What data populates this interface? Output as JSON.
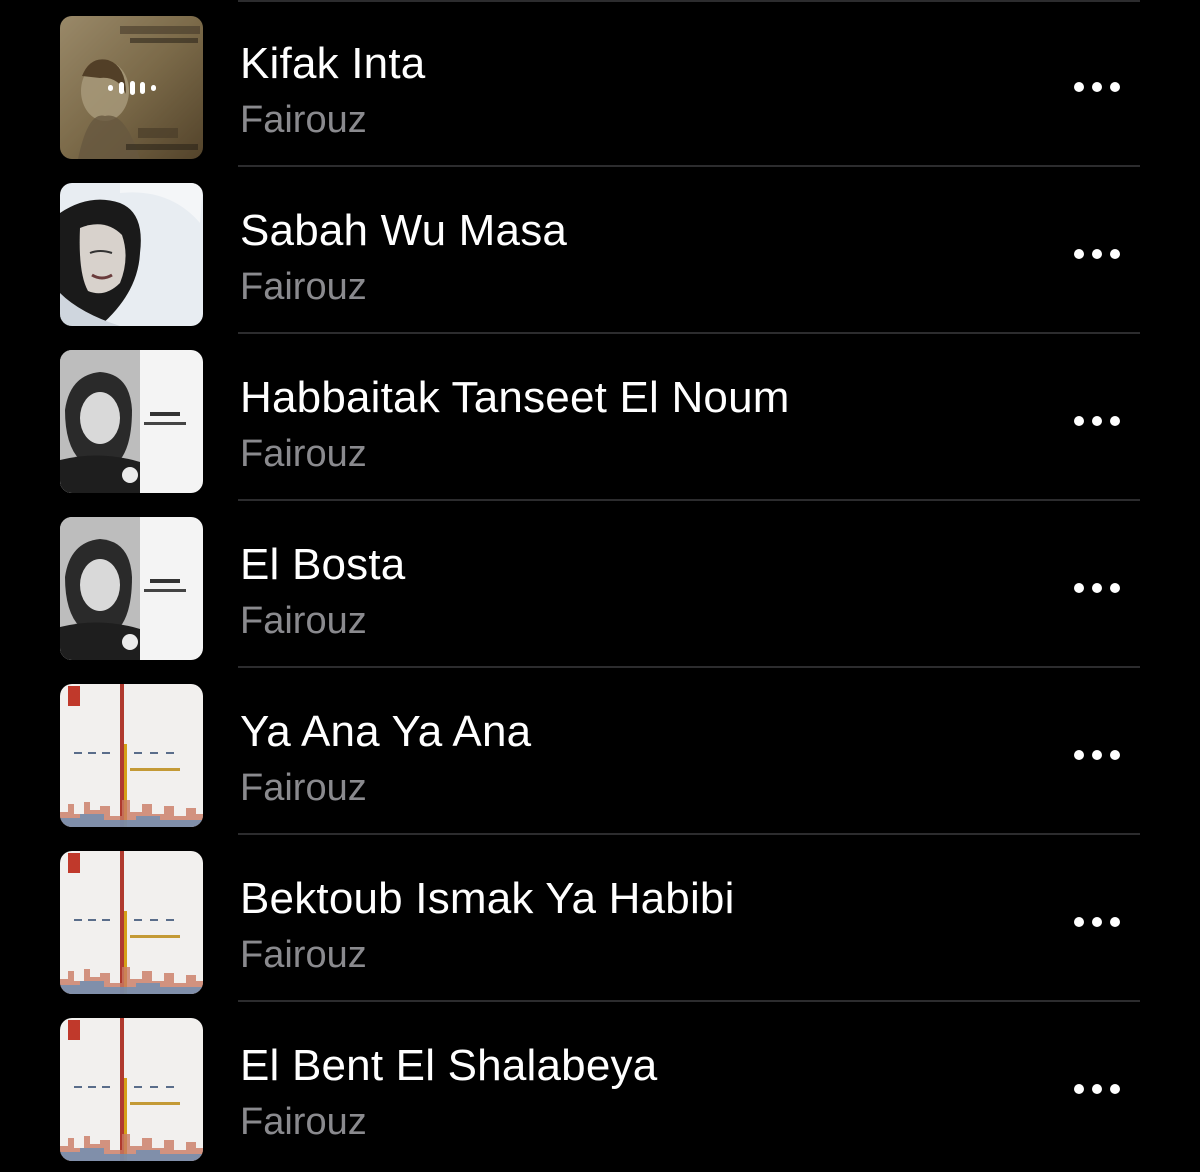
{
  "songs": [
    {
      "title": "Kifak Inta",
      "artist": "Fairouz",
      "artwork": "kifak-inta-cover",
      "now_playing": true
    },
    {
      "title": "Sabah Wu Masa",
      "artist": "Fairouz",
      "artwork": "portrait-cover"
    },
    {
      "title": "Habbaitak Tanseet El Noum",
      "artist": "Fairouz",
      "artwork": "bw-portrait-cover"
    },
    {
      "title": "El Bosta",
      "artist": "Fairouz",
      "artwork": "bw-portrait-cover"
    },
    {
      "title": "Ya Ana Ya Ana",
      "artist": "Fairouz",
      "artwork": "fairouz-world-cover"
    },
    {
      "title": "Bektoub Ismak Ya Habibi",
      "artist": "Fairouz",
      "artwork": "fairouz-world-cover"
    },
    {
      "title": "El Bent El Shalabeya",
      "artist": "Fairouz",
      "artwork": "fairouz-world-cover"
    }
  ],
  "icons": {
    "more": "more-options-icon",
    "now_playing": "now-playing-icon"
  },
  "colors": {
    "background": "#000000",
    "title": "#ffffff",
    "artist": "#8a8a8e",
    "separator": "#2c2c2e"
  }
}
